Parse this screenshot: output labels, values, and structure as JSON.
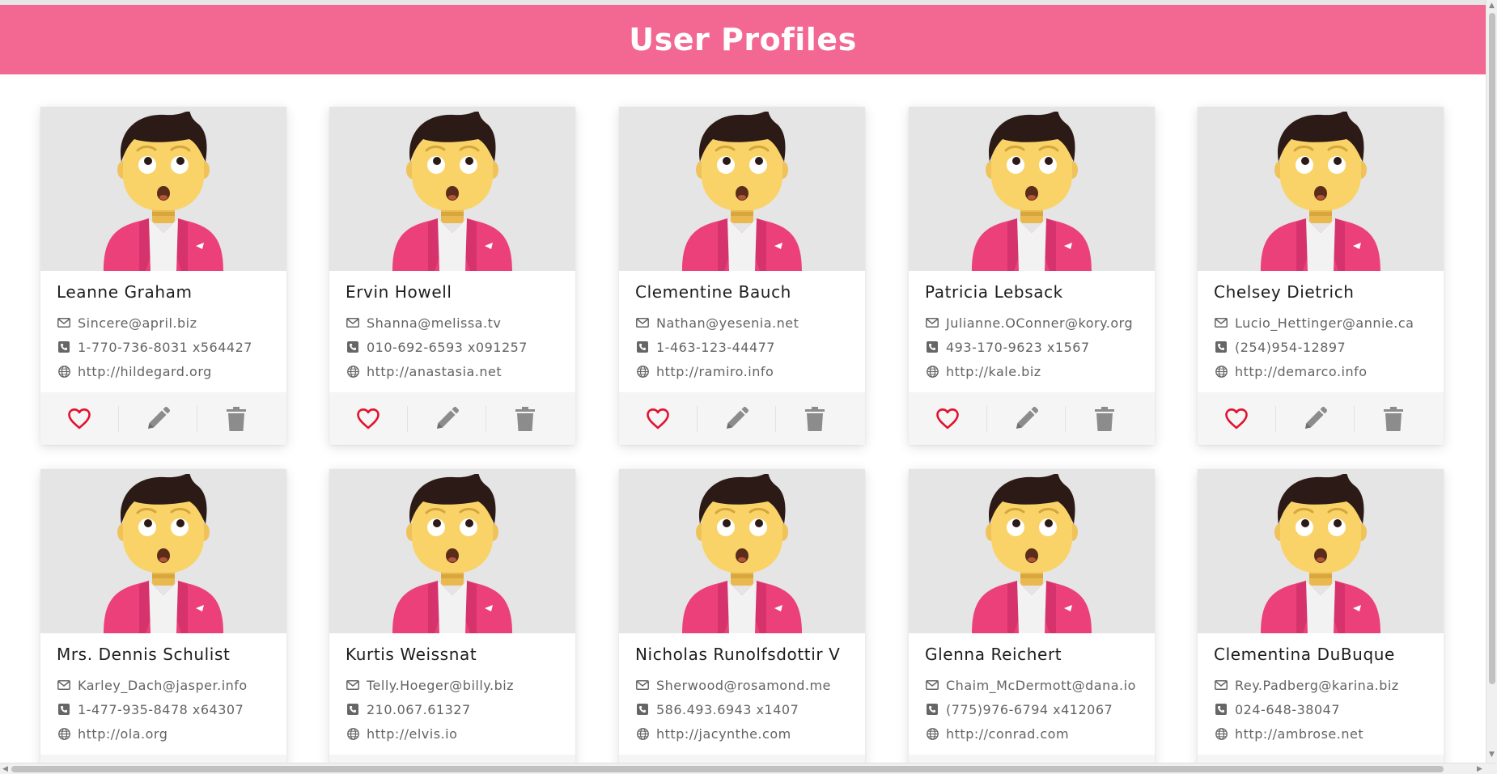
{
  "header": {
    "title": "User Profiles"
  },
  "colors": {
    "header_bg": "#f36893",
    "heart": "#e3122f",
    "icon_gray": "#8c8c8c",
    "jacket": "#ec407a",
    "skin": "#f9d368",
    "hair": "#2b1a16"
  },
  "icons": {
    "email": "envelope-icon",
    "phone": "phone-icon",
    "website": "globe-icon",
    "like": "heart-icon",
    "edit": "pencil-icon",
    "delete": "trash-icon",
    "avatar": "man-avatar-icon"
  },
  "users": [
    {
      "name": "Leanne Graham",
      "email": "Sincere@april.biz",
      "phone": "1-770-736-8031 x564427",
      "website": "http://hildegard.org"
    },
    {
      "name": "Ervin Howell",
      "email": "Shanna@melissa.tv",
      "phone": "010-692-6593 x091257",
      "website": "http://anastasia.net"
    },
    {
      "name": "Clementine Bauch",
      "email": "Nathan@yesenia.net",
      "phone": "1-463-123-44477",
      "website": "http://ramiro.info"
    },
    {
      "name": "Patricia Lebsack",
      "email": "Julianne.OConner@kory.org",
      "phone": "493-170-9623 x1567",
      "website": "http://kale.biz"
    },
    {
      "name": "Chelsey Dietrich",
      "email": "Lucio_Hettinger@annie.ca",
      "phone": "(254)954-12897",
      "website": "http://demarco.info"
    },
    {
      "name": "Mrs. Dennis Schulist",
      "email": "Karley_Dach@jasper.info",
      "phone": "1-477-935-8478 x64307",
      "website": "http://ola.org"
    },
    {
      "name": "Kurtis Weissnat",
      "email": "Telly.Hoeger@billy.biz",
      "phone": "210.067.61327",
      "website": "http://elvis.io"
    },
    {
      "name": "Nicholas Runolfsdottir V",
      "email": "Sherwood@rosamond.me",
      "phone": "586.493.6943 x1407",
      "website": "http://jacynthe.com"
    },
    {
      "name": "Glenna Reichert",
      "email": "Chaim_McDermott@dana.io",
      "phone": "(775)976-6794 x412067",
      "website": "http://conrad.com"
    },
    {
      "name": "Clementina DuBuque",
      "email": "Rey.Padberg@karina.biz",
      "phone": "024-648-38047",
      "website": "http://ambrose.net"
    }
  ]
}
